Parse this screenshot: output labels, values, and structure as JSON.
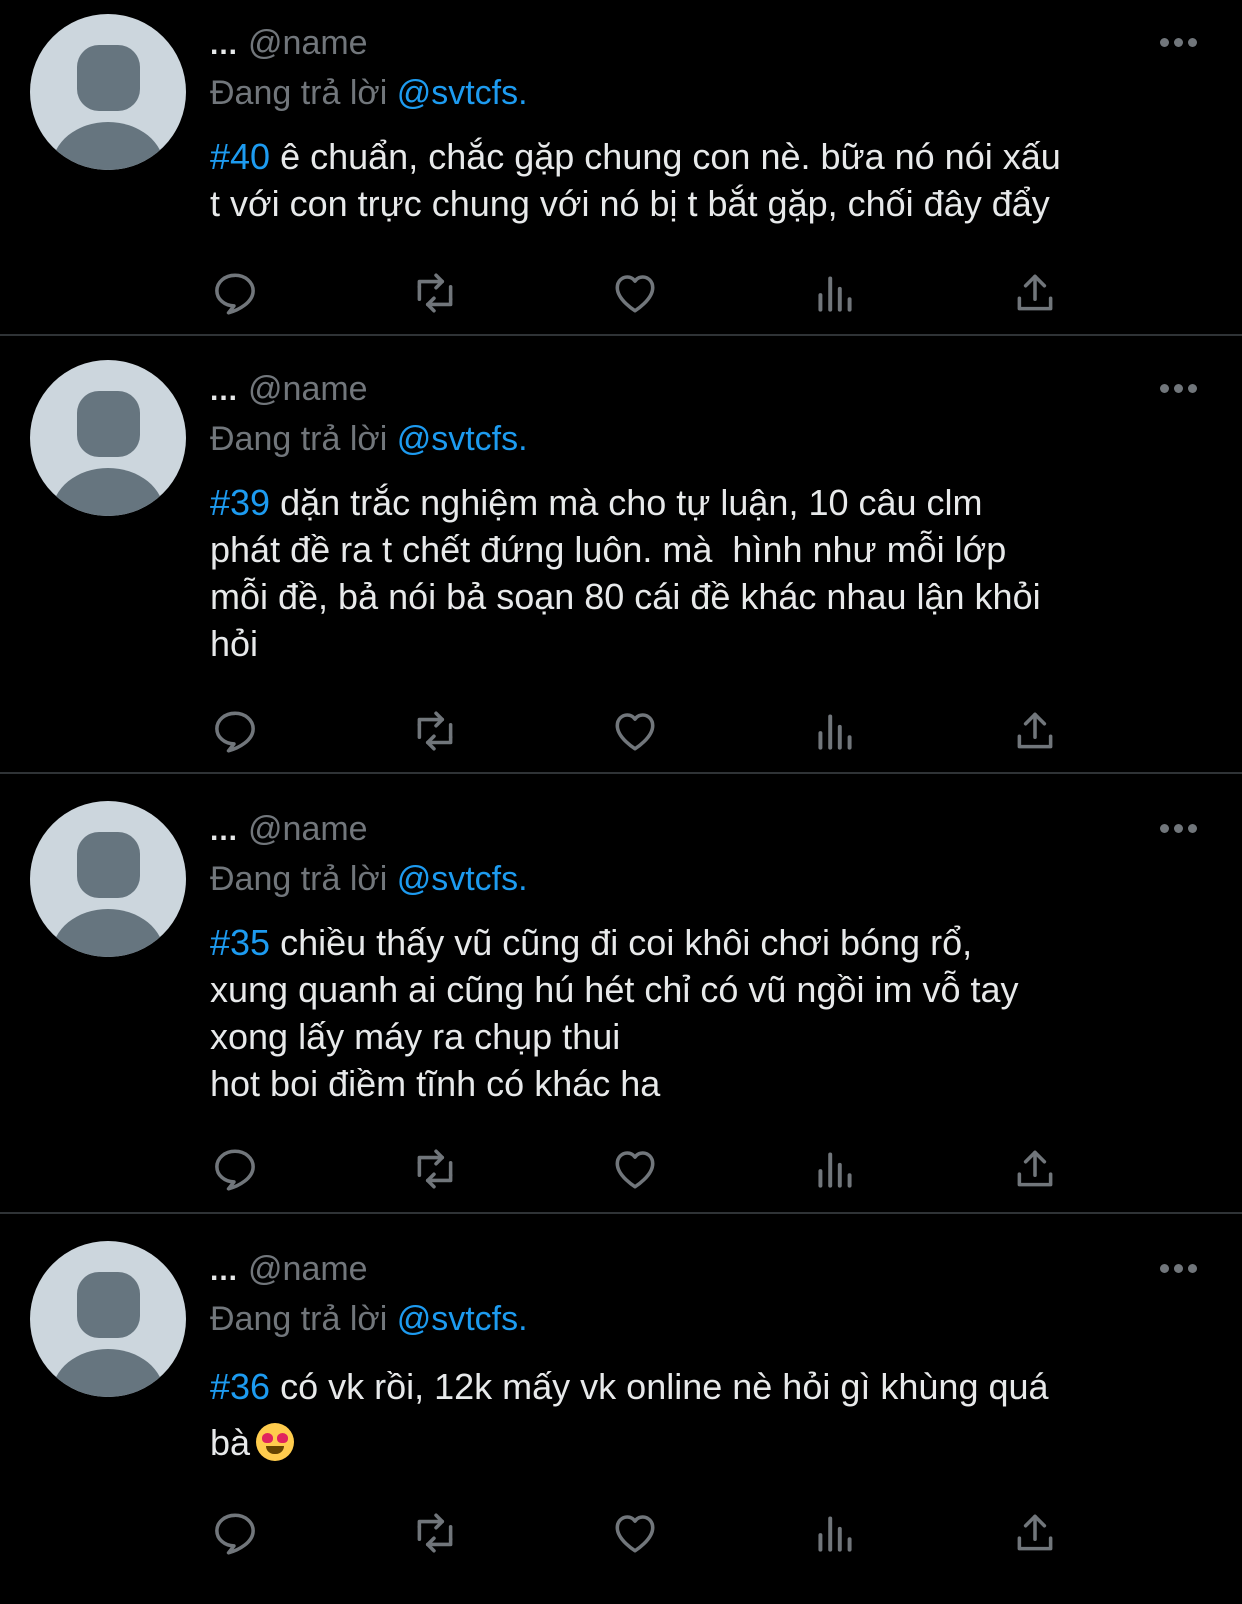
{
  "tweets": [
    {
      "prefix": "...",
      "handle": "@name",
      "replying_label": "Đang trả lời",
      "replying_to": "@svtcfs.",
      "tag": "#40",
      "text": " ê chuẩn, chắc gặp chung con nè. bữa nó nói xấu\nt với con trực chung với nó bị t bắt gặp, chối đây đẩy"
    },
    {
      "prefix": "...",
      "handle": "@name",
      "replying_label": "Đang trả lời",
      "replying_to": "@svtcfs.",
      "tag": "#39",
      "text": " dặn trắc nghiệm mà cho tự luận, 10 câu clm\nphát đề ra t chết đứng luôn. mà  hình như mỗi lớp\nmỗi đề, bả nói bả soạn 80 cái đề khác nhau lận khỏi\nhỏi"
    },
    {
      "prefix": "...",
      "handle": "@name",
      "replying_label": "Đang trả lời",
      "replying_to": "@svtcfs.",
      "tag": "#35",
      "text": " chiều thấy vũ cũng đi coi khôi chơi bóng rổ,\nxung quanh ai cũng hú hét chỉ có vũ ngồi im vỗ tay\nxong lấy máy ra chụp thui\nhot boi điềm tĩnh có khác ha"
    },
    {
      "prefix": "...",
      "handle": "@name",
      "replying_label": "Đang trả lời",
      "replying_to": "@svtcfs.",
      "tag": "#36",
      "text": " có vk rồi, 12k mấy vk online nè hỏi gì khùng quá\nbà",
      "emoji": "smiling-face-with-heart-eyes"
    }
  ],
  "actions": [
    "reply-icon",
    "retweet-icon",
    "like-icon",
    "views-icon",
    "share-icon"
  ],
  "colors": {
    "background": "#000000",
    "text": "#e7e9ea",
    "secondary": "#71767b",
    "accent": "#1d9bf0",
    "divider": "#2f3336"
  }
}
